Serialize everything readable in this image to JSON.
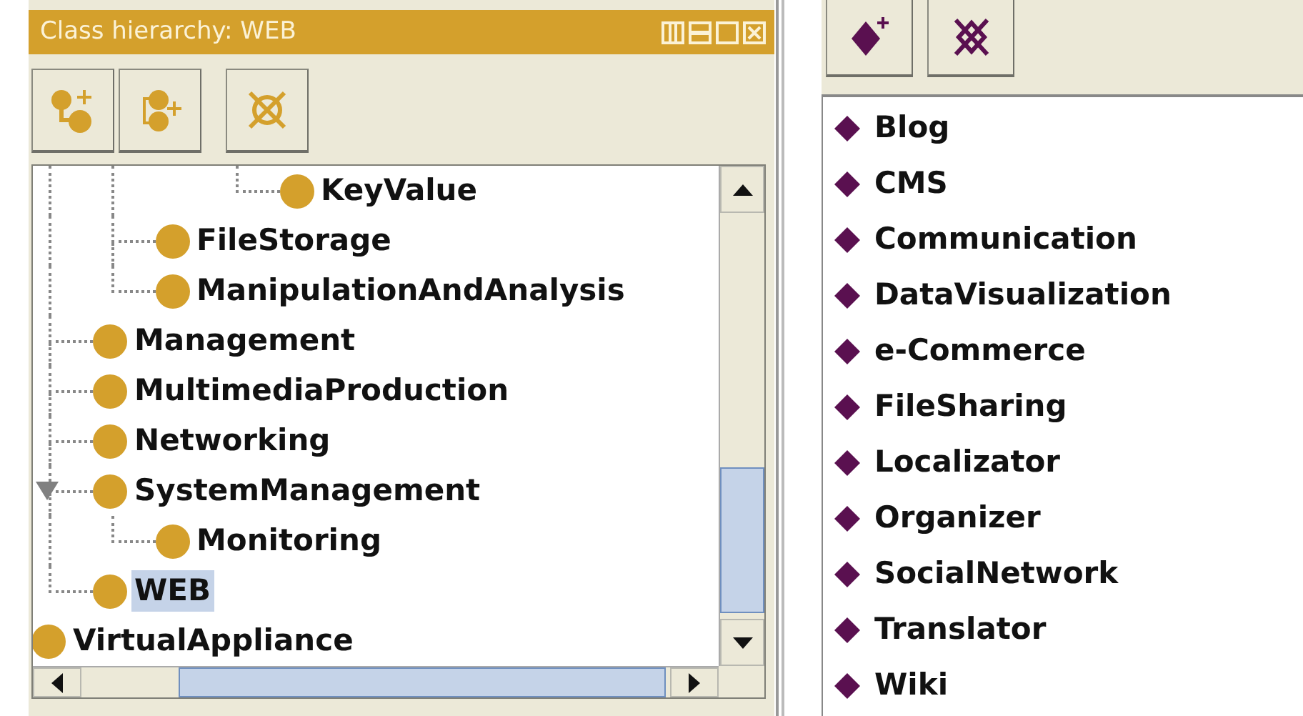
{
  "class_panel": {
    "title": "Class hierarchy: WEB",
    "tree": [
      {
        "children": [
          {
            "children": [
              {
                "children": [
                  {
                    "children": [
                      {
                        "label": "KeyValue",
                        "selected": false
                      }
                    ]
                  }
                ]
              },
              {
                "label": "FileStorage",
                "selected": false
              },
              {
                "label": "ManipulationAndAnalysis",
                "selected": false
              }
            ]
          },
          {
            "label": "Management",
            "selected": false
          },
          {
            "label": "MultimediaProduction",
            "selected": false
          },
          {
            "label": "Networking",
            "selected": false
          },
          {
            "label": "SystemManagement",
            "selected": false,
            "expanded": true,
            "children": [
              {
                "label": "Monitoring",
                "selected": false
              }
            ]
          },
          {
            "label": "WEB",
            "selected": true
          }
        ]
      },
      {
        "label": "VirtualAppliance",
        "selected": false
      }
    ]
  },
  "individuals_panel": {
    "items": [
      {
        "label": "Blog"
      },
      {
        "label": "CMS"
      },
      {
        "label": "Communication"
      },
      {
        "label": "DataVisualization"
      },
      {
        "label": "e-Commerce"
      },
      {
        "label": "FileSharing"
      },
      {
        "label": "Localizator"
      },
      {
        "label": "Organizer"
      },
      {
        "label": "SocialNetwork"
      },
      {
        "label": "Translator"
      },
      {
        "label": "Wiki"
      }
    ]
  }
}
